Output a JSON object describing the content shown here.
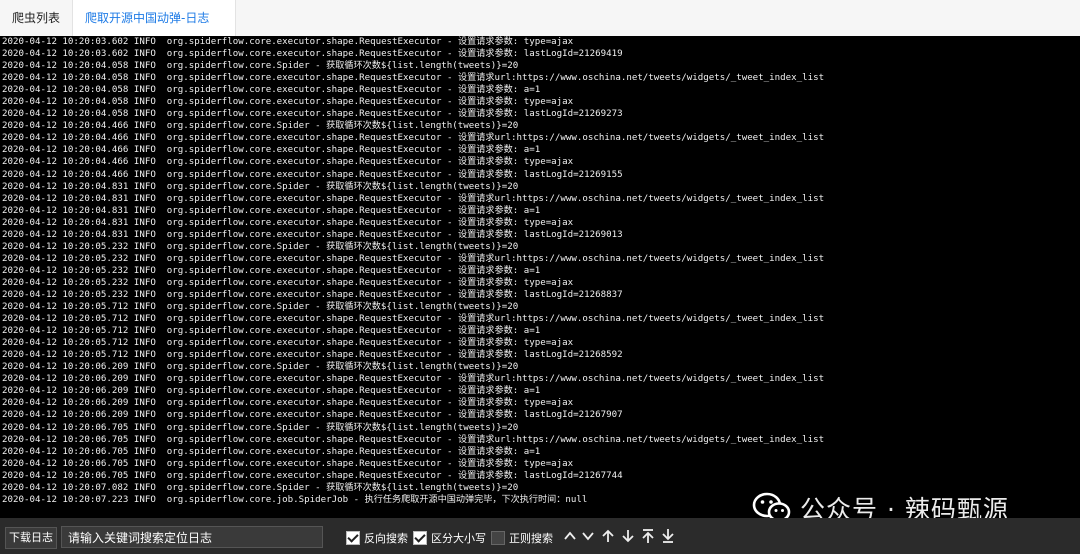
{
  "tabs": [
    {
      "label": "爬虫列表"
    },
    {
      "label": "爬取开源中国动弹-日志"
    }
  ],
  "log_lines": [
    "2020-04-12 10:20:03.602 INFO  org.spiderflow.core.executor.shape.RequestExecutor - 设置请求参数: type=ajax",
    "2020-04-12 10:20:03.602 INFO  org.spiderflow.core.executor.shape.RequestExecutor - 设置请求参数: lastLogId=21269419",
    "2020-04-12 10:20:04.058 INFO  org.spiderflow.core.Spider - 获取循环次数${list.length(tweets)}=20",
    "2020-04-12 10:20:04.058 INFO  org.spiderflow.core.executor.shape.RequestExecutor - 设置请求url:https://www.oschina.net/tweets/widgets/_tweet_index_list",
    "2020-04-12 10:20:04.058 INFO  org.spiderflow.core.executor.shape.RequestExecutor - 设置请求参数: a=1",
    "2020-04-12 10:20:04.058 INFO  org.spiderflow.core.executor.shape.RequestExecutor - 设置请求参数: type=ajax",
    "2020-04-12 10:20:04.058 INFO  org.spiderflow.core.executor.shape.RequestExecutor - 设置请求参数: lastLogId=21269273",
    "2020-04-12 10:20:04.466 INFO  org.spiderflow.core.Spider - 获取循环次数${list.length(tweets)}=20",
    "2020-04-12 10:20:04.466 INFO  org.spiderflow.core.executor.shape.RequestExecutor - 设置请求url:https://www.oschina.net/tweets/widgets/_tweet_index_list",
    "2020-04-12 10:20:04.466 INFO  org.spiderflow.core.executor.shape.RequestExecutor - 设置请求参数: a=1",
    "2020-04-12 10:20:04.466 INFO  org.spiderflow.core.executor.shape.RequestExecutor - 设置请求参数: type=ajax",
    "2020-04-12 10:20:04.466 INFO  org.spiderflow.core.executor.shape.RequestExecutor - 设置请求参数: lastLogId=21269155",
    "2020-04-12 10:20:04.831 INFO  org.spiderflow.core.Spider - 获取循环次数${list.length(tweets)}=20",
    "2020-04-12 10:20:04.831 INFO  org.spiderflow.core.executor.shape.RequestExecutor - 设置请求url:https://www.oschina.net/tweets/widgets/_tweet_index_list",
    "2020-04-12 10:20:04.831 INFO  org.spiderflow.core.executor.shape.RequestExecutor - 设置请求参数: a=1",
    "2020-04-12 10:20:04.831 INFO  org.spiderflow.core.executor.shape.RequestExecutor - 设置请求参数: type=ajax",
    "2020-04-12 10:20:04.831 INFO  org.spiderflow.core.executor.shape.RequestExecutor - 设置请求参数: lastLogId=21269013",
    "2020-04-12 10:20:05.232 INFO  org.spiderflow.core.Spider - 获取循环次数${list.length(tweets)}=20",
    "2020-04-12 10:20:05.232 INFO  org.spiderflow.core.executor.shape.RequestExecutor - 设置请求url:https://www.oschina.net/tweets/widgets/_tweet_index_list",
    "2020-04-12 10:20:05.232 INFO  org.spiderflow.core.executor.shape.RequestExecutor - 设置请求参数: a=1",
    "2020-04-12 10:20:05.232 INFO  org.spiderflow.core.executor.shape.RequestExecutor - 设置请求参数: type=ajax",
    "2020-04-12 10:20:05.232 INFO  org.spiderflow.core.executor.shape.RequestExecutor - 设置请求参数: lastLogId=21268837",
    "2020-04-12 10:20:05.712 INFO  org.spiderflow.core.Spider - 获取循环次数${list.length(tweets)}=20",
    "2020-04-12 10:20:05.712 INFO  org.spiderflow.core.executor.shape.RequestExecutor - 设置请求url:https://www.oschina.net/tweets/widgets/_tweet_index_list",
    "2020-04-12 10:20:05.712 INFO  org.spiderflow.core.executor.shape.RequestExecutor - 设置请求参数: a=1",
    "2020-04-12 10:20:05.712 INFO  org.spiderflow.core.executor.shape.RequestExecutor - 设置请求参数: type=ajax",
    "2020-04-12 10:20:05.712 INFO  org.spiderflow.core.executor.shape.RequestExecutor - 设置请求参数: lastLogId=21268592",
    "2020-04-12 10:20:06.209 INFO  org.spiderflow.core.Spider - 获取循环次数${list.length(tweets)}=20",
    "2020-04-12 10:20:06.209 INFO  org.spiderflow.core.executor.shape.RequestExecutor - 设置请求url:https://www.oschina.net/tweets/widgets/_tweet_index_list",
    "2020-04-12 10:20:06.209 INFO  org.spiderflow.core.executor.shape.RequestExecutor - 设置请求参数: a=1",
    "2020-04-12 10:20:06.209 INFO  org.spiderflow.core.executor.shape.RequestExecutor - 设置请求参数: type=ajax",
    "2020-04-12 10:20:06.209 INFO  org.spiderflow.core.executor.shape.RequestExecutor - 设置请求参数: lastLogId=21267907",
    "2020-04-12 10:20:06.705 INFO  org.spiderflow.core.Spider - 获取循环次数${list.length(tweets)}=20",
    "2020-04-12 10:20:06.705 INFO  org.spiderflow.core.executor.shape.RequestExecutor - 设置请求url:https://www.oschina.net/tweets/widgets/_tweet_index_list",
    "2020-04-12 10:20:06.705 INFO  org.spiderflow.core.executor.shape.RequestExecutor - 设置请求参数: a=1",
    "2020-04-12 10:20:06.705 INFO  org.spiderflow.core.executor.shape.RequestExecutor - 设置请求参数: type=ajax",
    "2020-04-12 10:20:06.705 INFO  org.spiderflow.core.executor.shape.RequestExecutor - 设置请求参数: lastLogId=21267744",
    "2020-04-12 10:20:07.082 INFO  org.spiderflow.core.Spider - 获取循环次数${list.length(tweets)}=20",
    "2020-04-12 10:20:07.223 INFO  org.spiderflow.core.job.SpiderJob - 执行任务爬取开源中国动弹完毕，下次执行时间：null"
  ],
  "watermark": {
    "text": "公众号 · 辣码甄源",
    "icon": "wechat-icon"
  },
  "toolbar": {
    "download_label": "下载日志",
    "search_value": "请输入关键词搜索定位日志",
    "reverse_search": {
      "label": "反向搜索",
      "checked": true
    },
    "case_sensitive": {
      "label": "区分大小写",
      "checked": true
    },
    "regex_search": {
      "label": "正则搜索",
      "checked": false
    },
    "nav_icons": [
      "chevron-up-icon",
      "chevron-down-icon",
      "arrow-up-icon",
      "arrow-down-icon",
      "to-top-icon",
      "to-bottom-icon"
    ]
  },
  "colors": {
    "accent": "#1e7be6",
    "log_bg": "#000000",
    "toolbar_bg": "#2b2b2b"
  }
}
